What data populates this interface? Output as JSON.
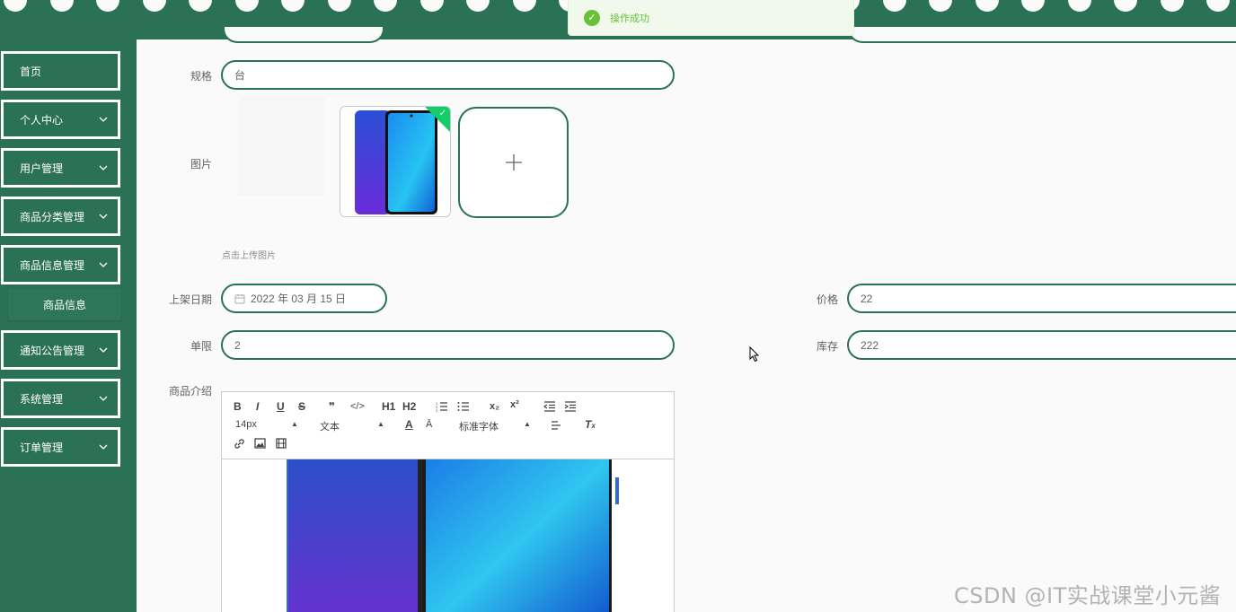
{
  "toast": {
    "message": "操作成功",
    "icon": "check-circle-icon"
  },
  "sidebar": {
    "items": [
      {
        "label": "首页",
        "has_chevron": false
      },
      {
        "label": "个人中心",
        "has_chevron": true
      },
      {
        "label": "用户管理",
        "has_chevron": true
      },
      {
        "label": "商品分类管理",
        "has_chevron": true
      },
      {
        "label": "商品信息管理",
        "has_chevron": true
      },
      {
        "label": "通知公告管理",
        "has_chevron": true
      },
      {
        "label": "系统管理",
        "has_chevron": true
      },
      {
        "label": "订单管理",
        "has_chevron": true
      }
    ],
    "submenu": {
      "label": "商品信息"
    }
  },
  "form": {
    "spec": {
      "label": "规格",
      "value": "台"
    },
    "image": {
      "label": "图片",
      "hint": "点击上传图片"
    },
    "date": {
      "label": "上架日期",
      "value": "2022 年 03 月 15 日"
    },
    "price": {
      "label": "价格",
      "value": "22"
    },
    "limit": {
      "label": "单限",
      "value": "2"
    },
    "stock": {
      "label": "库存",
      "value": "222"
    },
    "intro": {
      "label": "商品介绍"
    }
  },
  "editor": {
    "font_size": "14px",
    "text_type": "文本",
    "font_family": "标准字体",
    "buttons": {
      "bold": "B",
      "italic": "I",
      "underline": "U",
      "strike": "S",
      "quote": "❞",
      "code": "</>",
      "h1": "H1",
      "h2": "H2",
      "sub": "x₂",
      "sup": "x²"
    }
  },
  "watermark": "CSDN @IT实战课堂小元酱",
  "colors": {
    "primary": "#2a7155",
    "success": "#67c23a"
  }
}
